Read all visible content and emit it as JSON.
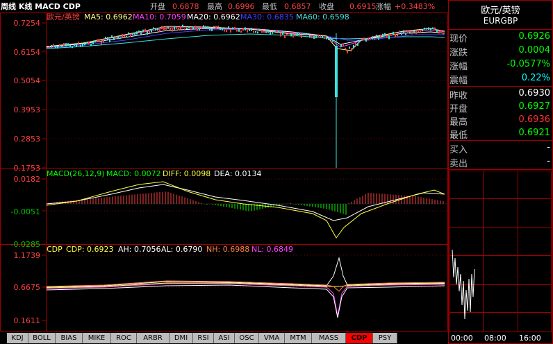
{
  "header": {
    "title": "周线 K线 MACD CDP",
    "open_label": "开盘",
    "open": "0.6878",
    "high_label": "最高",
    "high": "0.6996",
    "low_label": "最低",
    "low": "0.6857",
    "close_label": "收盘",
    "close": "0.6915",
    "change_label": "涨幅",
    "change": "+0.3483%"
  },
  "main_panel": {
    "name": "欧元/英镑",
    "ma5": "MA5: 0.6962",
    "ma10": "MA10: 0.7059",
    "ma20": "MA20: 0.6962",
    "ma30": "MA30: 0.6835",
    "ma60": "MA60: 0.6598",
    "y_ticks": [
      "0.7254",
      "0.6154",
      "0.5054",
      "0.3953",
      "0.2853",
      "0.1753"
    ]
  },
  "macd_panel": {
    "title": "MACD(26,12,9)",
    "macd": "MACD: 0.0072",
    "diff": "DIFF: 0.0098",
    "dea": "DEA: 0.0134",
    "y_ticks": [
      "0.0182",
      "-0.0051",
      "-0.0285"
    ]
  },
  "cdp_panel": {
    "title": "CDP",
    "cdp": "CDP: 0.6923",
    "ah": "AH: 0.7056",
    "al": "AL: 0.6790",
    "nh": "NH: 0.6988",
    "nl": "NL: 0.6849",
    "y_ticks": [
      "1.1739",
      "0.6675",
      "0.1611"
    ]
  },
  "right_panel": {
    "title": "欧元/英镑",
    "code": "EURGBP",
    "rows": [
      {
        "label": "现价",
        "value": "0.6926",
        "color": "#00ff00"
      },
      {
        "label": "涨跌",
        "value": "0.0004",
        "color": "#00ff00"
      },
      {
        "label": "涨幅",
        "value": "-0.0577%",
        "color": "#00ff00"
      },
      {
        "label": "震幅",
        "value": "0.22%",
        "color": "#00ffff"
      },
      {
        "label": "昨收",
        "value": "0.6930",
        "color": "#ffffff"
      },
      {
        "label": "开盘",
        "value": "0.6927",
        "color": "#00ff00"
      },
      {
        "label": "最高",
        "value": "0.6936",
        "color": "#ff3030"
      },
      {
        "label": "最低",
        "value": "0.6921",
        "color": "#00ff00"
      },
      {
        "label": "买入",
        "value": "-",
        "color": "#ffffff"
      },
      {
        "label": "卖出",
        "value": "-",
        "color": "#ffffff"
      }
    ],
    "time_labels": [
      "00:00",
      "08:00",
      "16:00"
    ]
  },
  "tabs": [
    "KDJ",
    "BOLL",
    "BIAS",
    "MIKE",
    "ROC",
    "ARBR",
    "DMI",
    "RSI",
    "ASI",
    "OSC",
    "VMA",
    "MTM",
    "MASS",
    "CDP",
    "PSY"
  ],
  "active_tab": "CDP"
}
